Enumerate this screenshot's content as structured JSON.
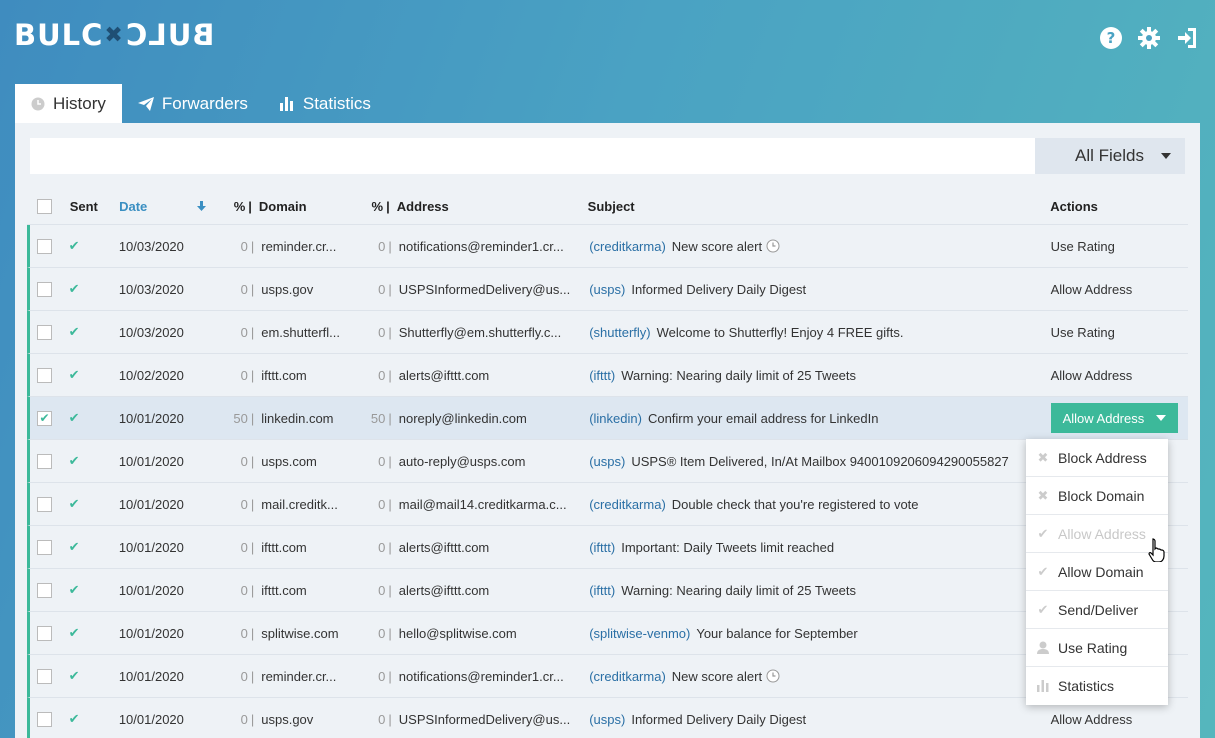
{
  "header": {
    "logo_left": "BULC",
    "logo_right": "BULC",
    "icons": [
      "help-icon",
      "gear-icon",
      "sign-out-icon"
    ]
  },
  "tabs": [
    {
      "label": "History",
      "icon": "clock-icon",
      "active": true
    },
    {
      "label": "Forwarders",
      "icon": "paper-plane-icon",
      "active": false
    },
    {
      "label": "Statistics",
      "icon": "bar-chart-icon",
      "active": false
    }
  ],
  "search": {
    "value": "",
    "placeholder": "",
    "field_select": "All Fields"
  },
  "table": {
    "headers": {
      "sent": "Sent",
      "date": "Date",
      "pct": "%",
      "domain": "Domain",
      "address": "Address",
      "subject": "Subject",
      "actions": "Actions"
    },
    "rows": [
      {
        "checked": false,
        "date": "10/03/2020",
        "pd": "0",
        "domain": "reminder.cr...",
        "pa": "0",
        "address": "notifications@reminder1.cr...",
        "tag": "(creditkarma)",
        "subject": "New score alert",
        "clock": true,
        "action": "Use Rating",
        "selected": false
      },
      {
        "checked": false,
        "date": "10/03/2020",
        "pd": "0",
        "domain": "usps.gov",
        "pa": "0",
        "address": "USPSInformedDelivery@us...",
        "tag": "(usps)",
        "subject": "Informed Delivery Daily Digest",
        "clock": false,
        "action": "Allow Address",
        "selected": false
      },
      {
        "checked": false,
        "date": "10/03/2020",
        "pd": "0",
        "domain": "em.shutterfl...",
        "pa": "0",
        "address": "Shutterfly@em.shutterfly.c...",
        "tag": "(shutterfly)",
        "subject": "Welcome to Shutterfly! Enjoy 4 FREE gifts.",
        "clock": false,
        "action": "Use Rating",
        "selected": false
      },
      {
        "checked": false,
        "date": "10/02/2020",
        "pd": "0",
        "domain": "ifttt.com",
        "pa": "0",
        "address": "alerts@ifttt.com",
        "tag": "(ifttt)",
        "subject": "Warning: Nearing daily limit of 25 Tweets",
        "clock": false,
        "action": "Allow Address",
        "selected": false
      },
      {
        "checked": true,
        "date": "10/01/2020",
        "pd": "50",
        "domain": "linkedin.com",
        "pa": "50",
        "address": "noreply@linkedin.com",
        "tag": "(linkedin)",
        "subject": "Confirm your email address for LinkedIn",
        "clock": false,
        "action": "Allow Address",
        "selected": true
      },
      {
        "checked": false,
        "date": "10/01/2020",
        "pd": "0",
        "domain": "usps.com",
        "pa": "0",
        "address": "auto-reply@usps.com",
        "tag": "(usps)",
        "subject": "USPS® Item Delivered, In/At Mailbox 9400109206094290055827",
        "clock": false,
        "action": "",
        "selected": false
      },
      {
        "checked": false,
        "date": "10/01/2020",
        "pd": "0",
        "domain": "mail.creditk...",
        "pa": "0",
        "address": "mail@mail14.creditkarma.c...",
        "tag": "(creditkarma)",
        "subject": "Double check that you're registered to vote",
        "clock": false,
        "action": "",
        "selected": false
      },
      {
        "checked": false,
        "date": "10/01/2020",
        "pd": "0",
        "domain": "ifttt.com",
        "pa": "0",
        "address": "alerts@ifttt.com",
        "tag": "(ifttt)",
        "subject": "Important: Daily Tweets limit reached",
        "clock": false,
        "action": "",
        "selected": false
      },
      {
        "checked": false,
        "date": "10/01/2020",
        "pd": "0",
        "domain": "ifttt.com",
        "pa": "0",
        "address": "alerts@ifttt.com",
        "tag": "(ifttt)",
        "subject": "Warning: Nearing daily limit of 25 Tweets",
        "clock": false,
        "action": "",
        "selected": false
      },
      {
        "checked": false,
        "date": "10/01/2020",
        "pd": "0",
        "domain": "splitwise.com",
        "pa": "0",
        "address": "hello@splitwise.com",
        "tag": "(splitwise-venmo)",
        "subject": "Your balance for September",
        "clock": false,
        "action": "",
        "selected": false
      },
      {
        "checked": false,
        "date": "10/01/2020",
        "pd": "0",
        "domain": "reminder.cr...",
        "pa": "0",
        "address": "notifications@reminder1.cr...",
        "tag": "(creditkarma)",
        "subject": "New score alert",
        "clock": true,
        "action": "",
        "selected": false
      },
      {
        "checked": false,
        "date": "10/01/2020",
        "pd": "0",
        "domain": "usps.gov",
        "pa": "0",
        "address": "USPSInformedDelivery@us...",
        "tag": "(usps)",
        "subject": "Informed Delivery Daily Digest",
        "clock": false,
        "action": "Allow Address",
        "selected": false
      }
    ]
  },
  "menu": {
    "items": [
      {
        "label": "Block Address",
        "icon": "x-icon",
        "disabled": false
      },
      {
        "label": "Block Domain",
        "icon": "x-icon",
        "disabled": false
      },
      {
        "label": "Allow Address",
        "icon": "check-icon",
        "disabled": true
      },
      {
        "label": "Allow Domain",
        "icon": "check-icon",
        "disabled": false
      },
      {
        "label": "Send/Deliver",
        "icon": "check-icon",
        "disabled": false
      },
      {
        "label": "Use Rating",
        "icon": "user-icon",
        "disabled": false
      },
      {
        "label": "Statistics",
        "icon": "bar-chart-icon",
        "disabled": false
      }
    ]
  },
  "colors": {
    "accent": "#3cb99a",
    "link": "#2a6fa5",
    "sort": "#3a8fc2"
  }
}
